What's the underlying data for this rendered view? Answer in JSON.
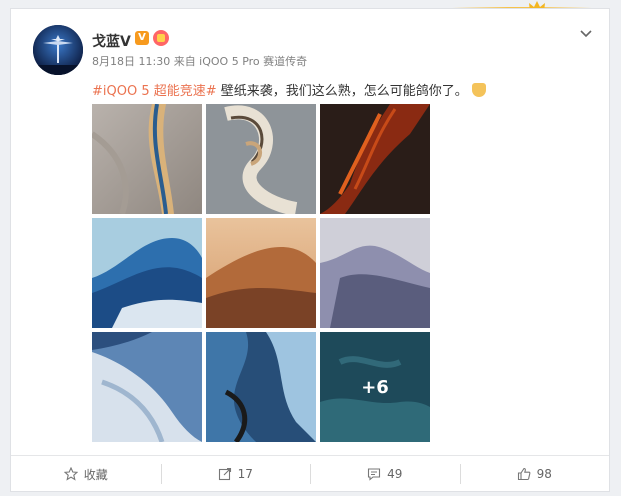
{
  "post": {
    "username": "戈蓝V",
    "vip_badge": "V",
    "meta": "8月18日 11:30 来自 iQOO 5 Pro 赛道传奇",
    "hashtag": "#iQOO 5 超能竞速#",
    "body": "壁纸来袭，我们这么熟，怎么可能鸽你了。",
    "more_count": "+6"
  },
  "actions": {
    "favorite_label": "收藏",
    "repost_count": "17",
    "comment_count": "49",
    "like_count": "98"
  },
  "colors": {
    "hashtag": "#eb7350",
    "vip": "#f79a1e"
  }
}
